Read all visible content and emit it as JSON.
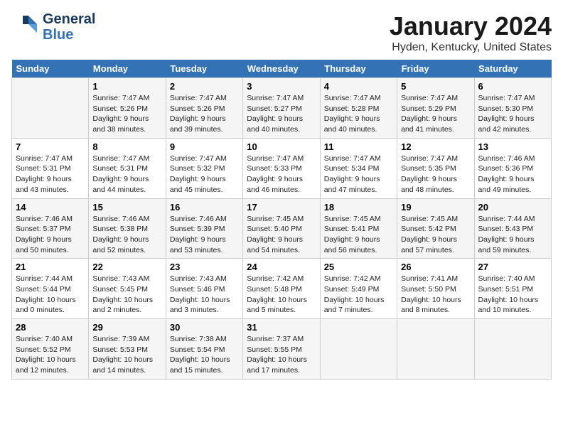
{
  "logo": {
    "text_general": "General",
    "text_blue": "Blue"
  },
  "title": "January 2024",
  "subtitle": "Hyden, Kentucky, United States",
  "days_of_week": [
    "Sunday",
    "Monday",
    "Tuesday",
    "Wednesday",
    "Thursday",
    "Friday",
    "Saturday"
  ],
  "weeks": [
    [
      {
        "num": "",
        "sunrise": "",
        "sunset": "",
        "daylight": ""
      },
      {
        "num": "1",
        "sunrise": "Sunrise: 7:47 AM",
        "sunset": "Sunset: 5:26 PM",
        "daylight": "Daylight: 9 hours and 38 minutes."
      },
      {
        "num": "2",
        "sunrise": "Sunrise: 7:47 AM",
        "sunset": "Sunset: 5:26 PM",
        "daylight": "Daylight: 9 hours and 39 minutes."
      },
      {
        "num": "3",
        "sunrise": "Sunrise: 7:47 AM",
        "sunset": "Sunset: 5:27 PM",
        "daylight": "Daylight: 9 hours and 40 minutes."
      },
      {
        "num": "4",
        "sunrise": "Sunrise: 7:47 AM",
        "sunset": "Sunset: 5:28 PM",
        "daylight": "Daylight: 9 hours and 40 minutes."
      },
      {
        "num": "5",
        "sunrise": "Sunrise: 7:47 AM",
        "sunset": "Sunset: 5:29 PM",
        "daylight": "Daylight: 9 hours and 41 minutes."
      },
      {
        "num": "6",
        "sunrise": "Sunrise: 7:47 AM",
        "sunset": "Sunset: 5:30 PM",
        "daylight": "Daylight: 9 hours and 42 minutes."
      }
    ],
    [
      {
        "num": "7",
        "sunrise": "Sunrise: 7:47 AM",
        "sunset": "Sunset: 5:31 PM",
        "daylight": "Daylight: 9 hours and 43 minutes."
      },
      {
        "num": "8",
        "sunrise": "Sunrise: 7:47 AM",
        "sunset": "Sunset: 5:31 PM",
        "daylight": "Daylight: 9 hours and 44 minutes."
      },
      {
        "num": "9",
        "sunrise": "Sunrise: 7:47 AM",
        "sunset": "Sunset: 5:32 PM",
        "daylight": "Daylight: 9 hours and 45 minutes."
      },
      {
        "num": "10",
        "sunrise": "Sunrise: 7:47 AM",
        "sunset": "Sunset: 5:33 PM",
        "daylight": "Daylight: 9 hours and 46 minutes."
      },
      {
        "num": "11",
        "sunrise": "Sunrise: 7:47 AM",
        "sunset": "Sunset: 5:34 PM",
        "daylight": "Daylight: 9 hours and 47 minutes."
      },
      {
        "num": "12",
        "sunrise": "Sunrise: 7:47 AM",
        "sunset": "Sunset: 5:35 PM",
        "daylight": "Daylight: 9 hours and 48 minutes."
      },
      {
        "num": "13",
        "sunrise": "Sunrise: 7:46 AM",
        "sunset": "Sunset: 5:36 PM",
        "daylight": "Daylight: 9 hours and 49 minutes."
      }
    ],
    [
      {
        "num": "14",
        "sunrise": "Sunrise: 7:46 AM",
        "sunset": "Sunset: 5:37 PM",
        "daylight": "Daylight: 9 hours and 50 minutes."
      },
      {
        "num": "15",
        "sunrise": "Sunrise: 7:46 AM",
        "sunset": "Sunset: 5:38 PM",
        "daylight": "Daylight: 9 hours and 52 minutes."
      },
      {
        "num": "16",
        "sunrise": "Sunrise: 7:46 AM",
        "sunset": "Sunset: 5:39 PM",
        "daylight": "Daylight: 9 hours and 53 minutes."
      },
      {
        "num": "17",
        "sunrise": "Sunrise: 7:45 AM",
        "sunset": "Sunset: 5:40 PM",
        "daylight": "Daylight: 9 hours and 54 minutes."
      },
      {
        "num": "18",
        "sunrise": "Sunrise: 7:45 AM",
        "sunset": "Sunset: 5:41 PM",
        "daylight": "Daylight: 9 hours and 56 minutes."
      },
      {
        "num": "19",
        "sunrise": "Sunrise: 7:45 AM",
        "sunset": "Sunset: 5:42 PM",
        "daylight": "Daylight: 9 hours and 57 minutes."
      },
      {
        "num": "20",
        "sunrise": "Sunrise: 7:44 AM",
        "sunset": "Sunset: 5:43 PM",
        "daylight": "Daylight: 9 hours and 59 minutes."
      }
    ],
    [
      {
        "num": "21",
        "sunrise": "Sunrise: 7:44 AM",
        "sunset": "Sunset: 5:44 PM",
        "daylight": "Daylight: 10 hours and 0 minutes."
      },
      {
        "num": "22",
        "sunrise": "Sunrise: 7:43 AM",
        "sunset": "Sunset: 5:45 PM",
        "daylight": "Daylight: 10 hours and 2 minutes."
      },
      {
        "num": "23",
        "sunrise": "Sunrise: 7:43 AM",
        "sunset": "Sunset: 5:46 PM",
        "daylight": "Daylight: 10 hours and 3 minutes."
      },
      {
        "num": "24",
        "sunrise": "Sunrise: 7:42 AM",
        "sunset": "Sunset: 5:48 PM",
        "daylight": "Daylight: 10 hours and 5 minutes."
      },
      {
        "num": "25",
        "sunrise": "Sunrise: 7:42 AM",
        "sunset": "Sunset: 5:49 PM",
        "daylight": "Daylight: 10 hours and 7 minutes."
      },
      {
        "num": "26",
        "sunrise": "Sunrise: 7:41 AM",
        "sunset": "Sunset: 5:50 PM",
        "daylight": "Daylight: 10 hours and 8 minutes."
      },
      {
        "num": "27",
        "sunrise": "Sunrise: 7:40 AM",
        "sunset": "Sunset: 5:51 PM",
        "daylight": "Daylight: 10 hours and 10 minutes."
      }
    ],
    [
      {
        "num": "28",
        "sunrise": "Sunrise: 7:40 AM",
        "sunset": "Sunset: 5:52 PM",
        "daylight": "Daylight: 10 hours and 12 minutes."
      },
      {
        "num": "29",
        "sunrise": "Sunrise: 7:39 AM",
        "sunset": "Sunset: 5:53 PM",
        "daylight": "Daylight: 10 hours and 14 minutes."
      },
      {
        "num": "30",
        "sunrise": "Sunrise: 7:38 AM",
        "sunset": "Sunset: 5:54 PM",
        "daylight": "Daylight: 10 hours and 15 minutes."
      },
      {
        "num": "31",
        "sunrise": "Sunrise: 7:37 AM",
        "sunset": "Sunset: 5:55 PM",
        "daylight": "Daylight: 10 hours and 17 minutes."
      },
      {
        "num": "",
        "sunrise": "",
        "sunset": "",
        "daylight": ""
      },
      {
        "num": "",
        "sunrise": "",
        "sunset": "",
        "daylight": ""
      },
      {
        "num": "",
        "sunrise": "",
        "sunset": "",
        "daylight": ""
      }
    ]
  ]
}
